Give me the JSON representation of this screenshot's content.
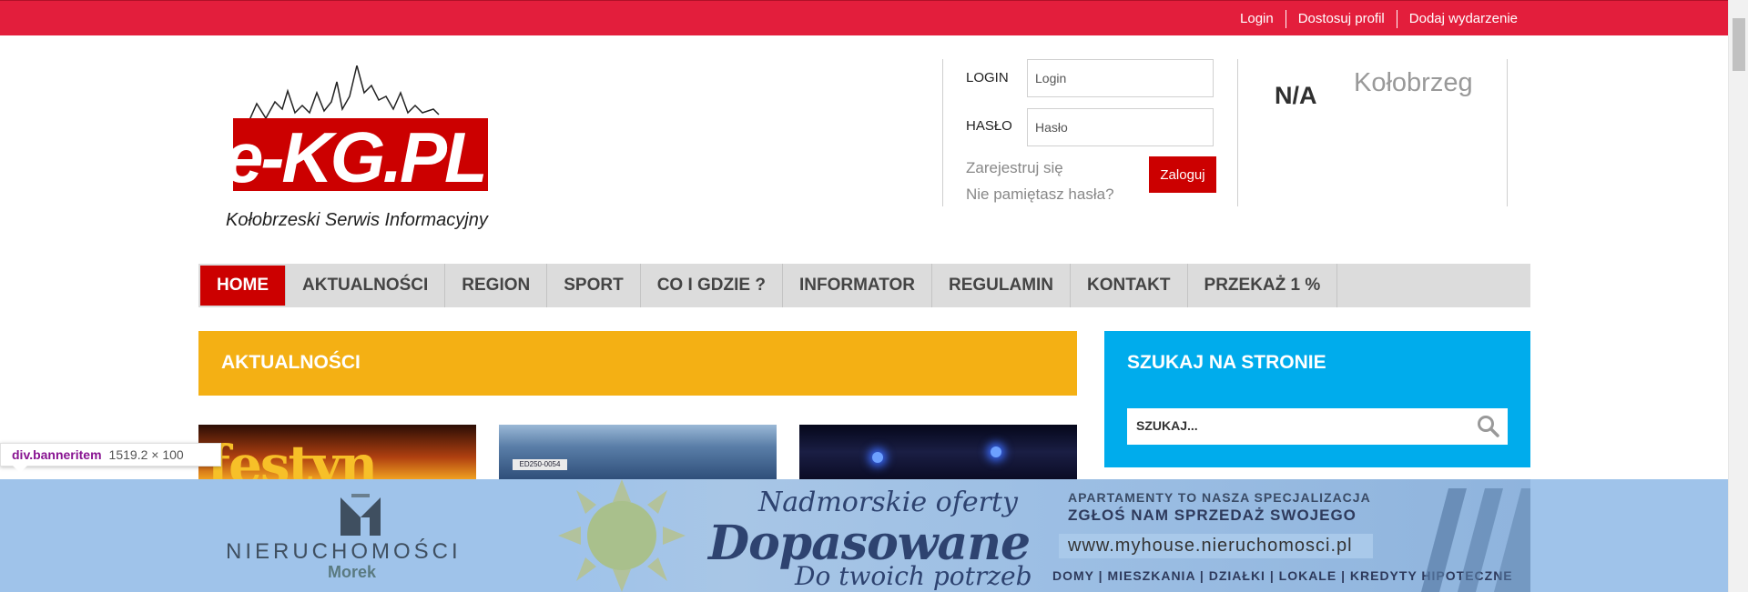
{
  "topbar": {
    "links": [
      "Login",
      "Dostosuj profil",
      "Dodaj wydarzenie"
    ]
  },
  "logo": {
    "brand": "e-KG.PL",
    "tagline": "Kołobrzeski Serwis Informacyjny"
  },
  "login_form": {
    "login_label": "LOGIN",
    "login_placeholder": "Login",
    "password_label": "HASŁO",
    "password_placeholder": "Hasło",
    "register_link": "Zarejestruj się",
    "forgot_link": "Nie pamiętasz hasła?",
    "submit_label": "Zaloguj"
  },
  "weather": {
    "value": "N/A",
    "city": "Kołobrzeg"
  },
  "nav": {
    "items": [
      "HOME",
      "AKTUALNOŚCI",
      "REGION",
      "SPORT",
      "CO I GDZIE ?",
      "INFORMATOR",
      "REGULAMIN",
      "KONTAKT",
      "PRZEKAŻ 1 %"
    ],
    "active": "HOME"
  },
  "main": {
    "section_title": "AKTUALNOŚCI"
  },
  "search": {
    "title": "SZUKAJ NA STRONIE",
    "placeholder": "SZUKAJ..."
  },
  "thumbnails": {
    "t1_text": "festyn",
    "t2_plate": "ED250-0054"
  },
  "devtools_tooltip": {
    "selector": "div.banneritem",
    "dimensions": "1519.2 × 100"
  },
  "banner": {
    "brand": "NIERUCHOMOŚCI",
    "brand_sub": "Morek",
    "headline_1": "Nadmorskie oferty",
    "headline_2": "Dopasowane",
    "headline_3": "Do twoich potrzeb",
    "apt_line_1": "APARTAMENTY TO NASZA SPECJALIZACJA",
    "apt_line_2": "ZGŁOŚ NAM SPRZEDAŻ SWOJEGO",
    "url": "www.myhouse.nieruchomosci.pl",
    "categories": "DOMY | MIESZKANIA | DZIAŁKI | LOKALE | KREDYTY HIPOTECZNE"
  },
  "colors": {
    "topbar": "#e31e3c",
    "nav_active": "#cc0000",
    "section_head": "#f4b014",
    "search_panel": "#00acec"
  }
}
